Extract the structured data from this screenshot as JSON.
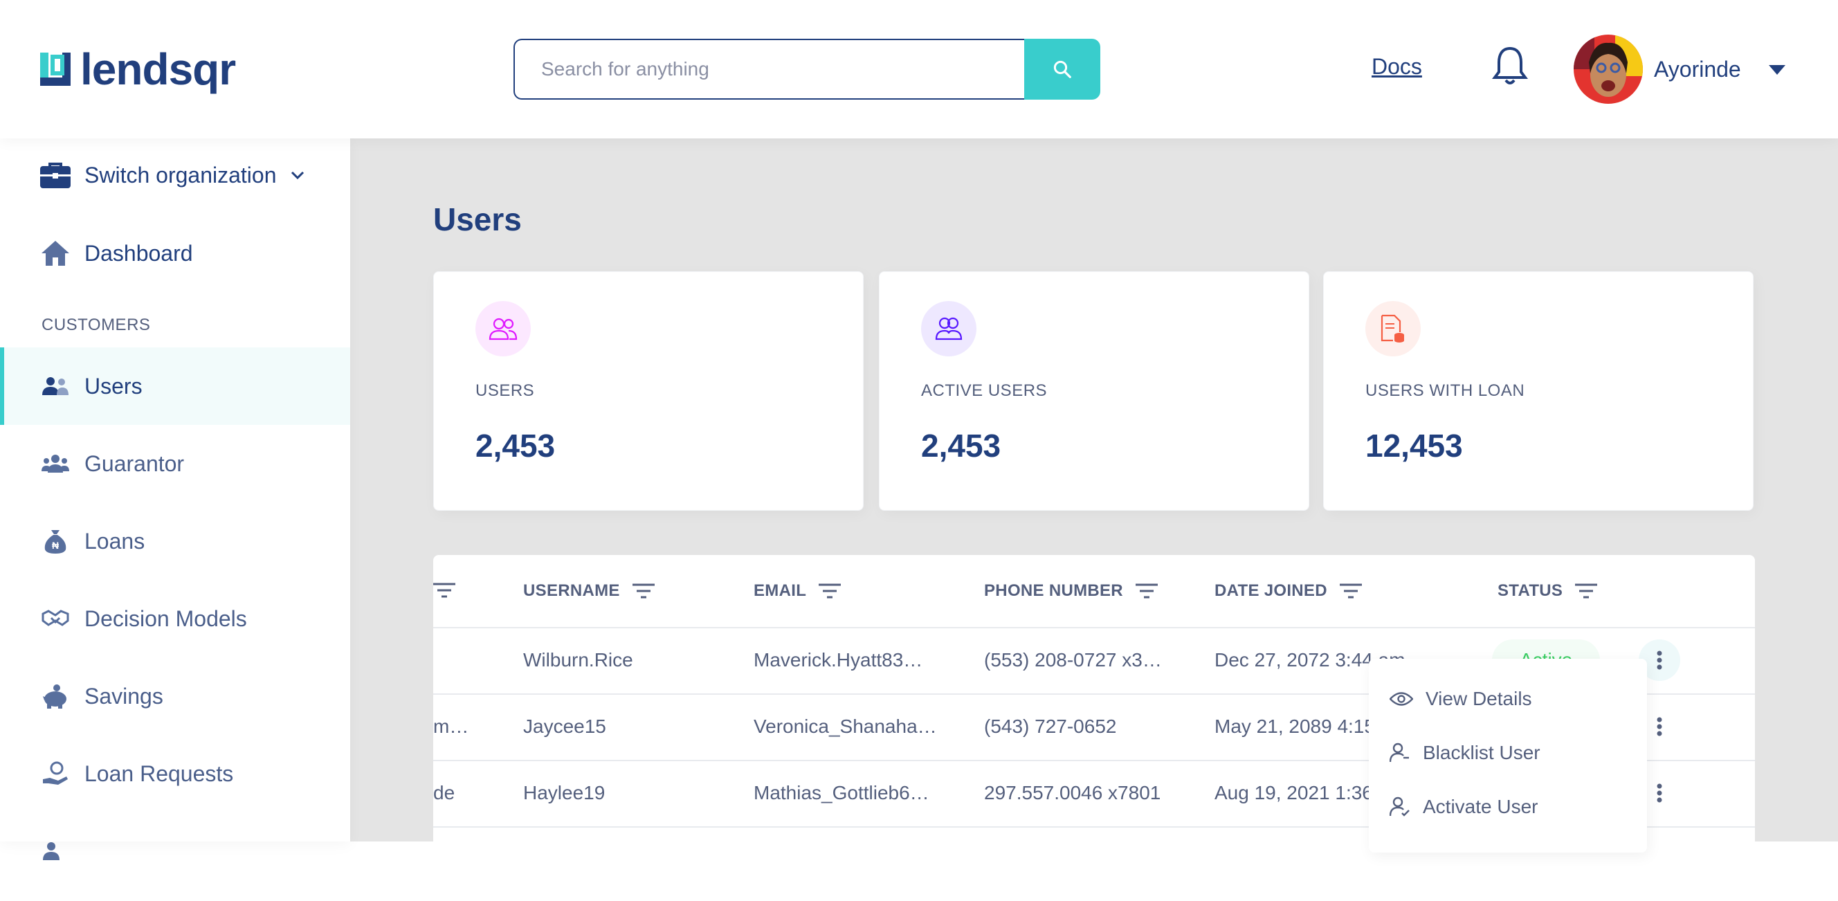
{
  "header": {
    "logo_text": "lendsqr",
    "search_placeholder": "Search for anything",
    "docs_label": "Docs",
    "user_name": "Ayorinde"
  },
  "sidebar": {
    "switch_org_label": "Switch organization",
    "dashboard_label": "Dashboard",
    "section_customers": "CUSTOMERS",
    "items": [
      {
        "label": "Users",
        "icon": "users-icon",
        "active": true
      },
      {
        "label": "Guarantor",
        "icon": "guarantor-icon"
      },
      {
        "label": "Loans",
        "icon": "loan-sack-icon"
      },
      {
        "label": "Decision Models",
        "icon": "handshake-icon"
      },
      {
        "label": "Savings",
        "icon": "piggy-bank-icon"
      },
      {
        "label": "Loan Requests",
        "icon": "hand-money-icon"
      }
    ]
  },
  "main": {
    "title": "Users",
    "cards": [
      {
        "label": "USERS",
        "value": "2,453",
        "icon": "users-icon",
        "color": "#DF18FF"
      },
      {
        "label": "ACTIVE USERS",
        "value": "2,453",
        "icon": "active-users-icon",
        "color": "#5718FF"
      },
      {
        "label": "USERS WITH LOAN",
        "value": "12,453",
        "icon": "loan-document-icon",
        "color": "#F55F44"
      }
    ],
    "table": {
      "columns": [
        "USERNAME",
        "EMAIL",
        "PHONE NUMBER",
        "DATE JOINED",
        "STATUS"
      ],
      "rows": [
        {
          "org": "",
          "username": "Wilburn.Rice",
          "email": "Maverick.Hyatt83…",
          "phone": "(553) 208-0727 x3…",
          "date": "Dec 27, 2072 3:44 am",
          "status": "Active"
        },
        {
          "org": "m…",
          "username": "Jaycee15",
          "email": "Veronica_Shanaha…",
          "phone": "(543) 727-0652",
          "date": "May 21, 2089 4:15",
          "status": ""
        },
        {
          "org": "de",
          "username": "Haylee19",
          "email": "Mathias_Gottlieb6…",
          "phone": "297.557.0046 x7801",
          "date": "Aug 19, 2021 1:36",
          "status": ""
        }
      ]
    },
    "menu": [
      "View Details",
      "Blacklist User",
      "Activate User"
    ]
  },
  "colors": {
    "primary": "#213F7D",
    "accent": "#39CDCC",
    "muted": "#545F7D",
    "active_status": "#39CD62"
  }
}
